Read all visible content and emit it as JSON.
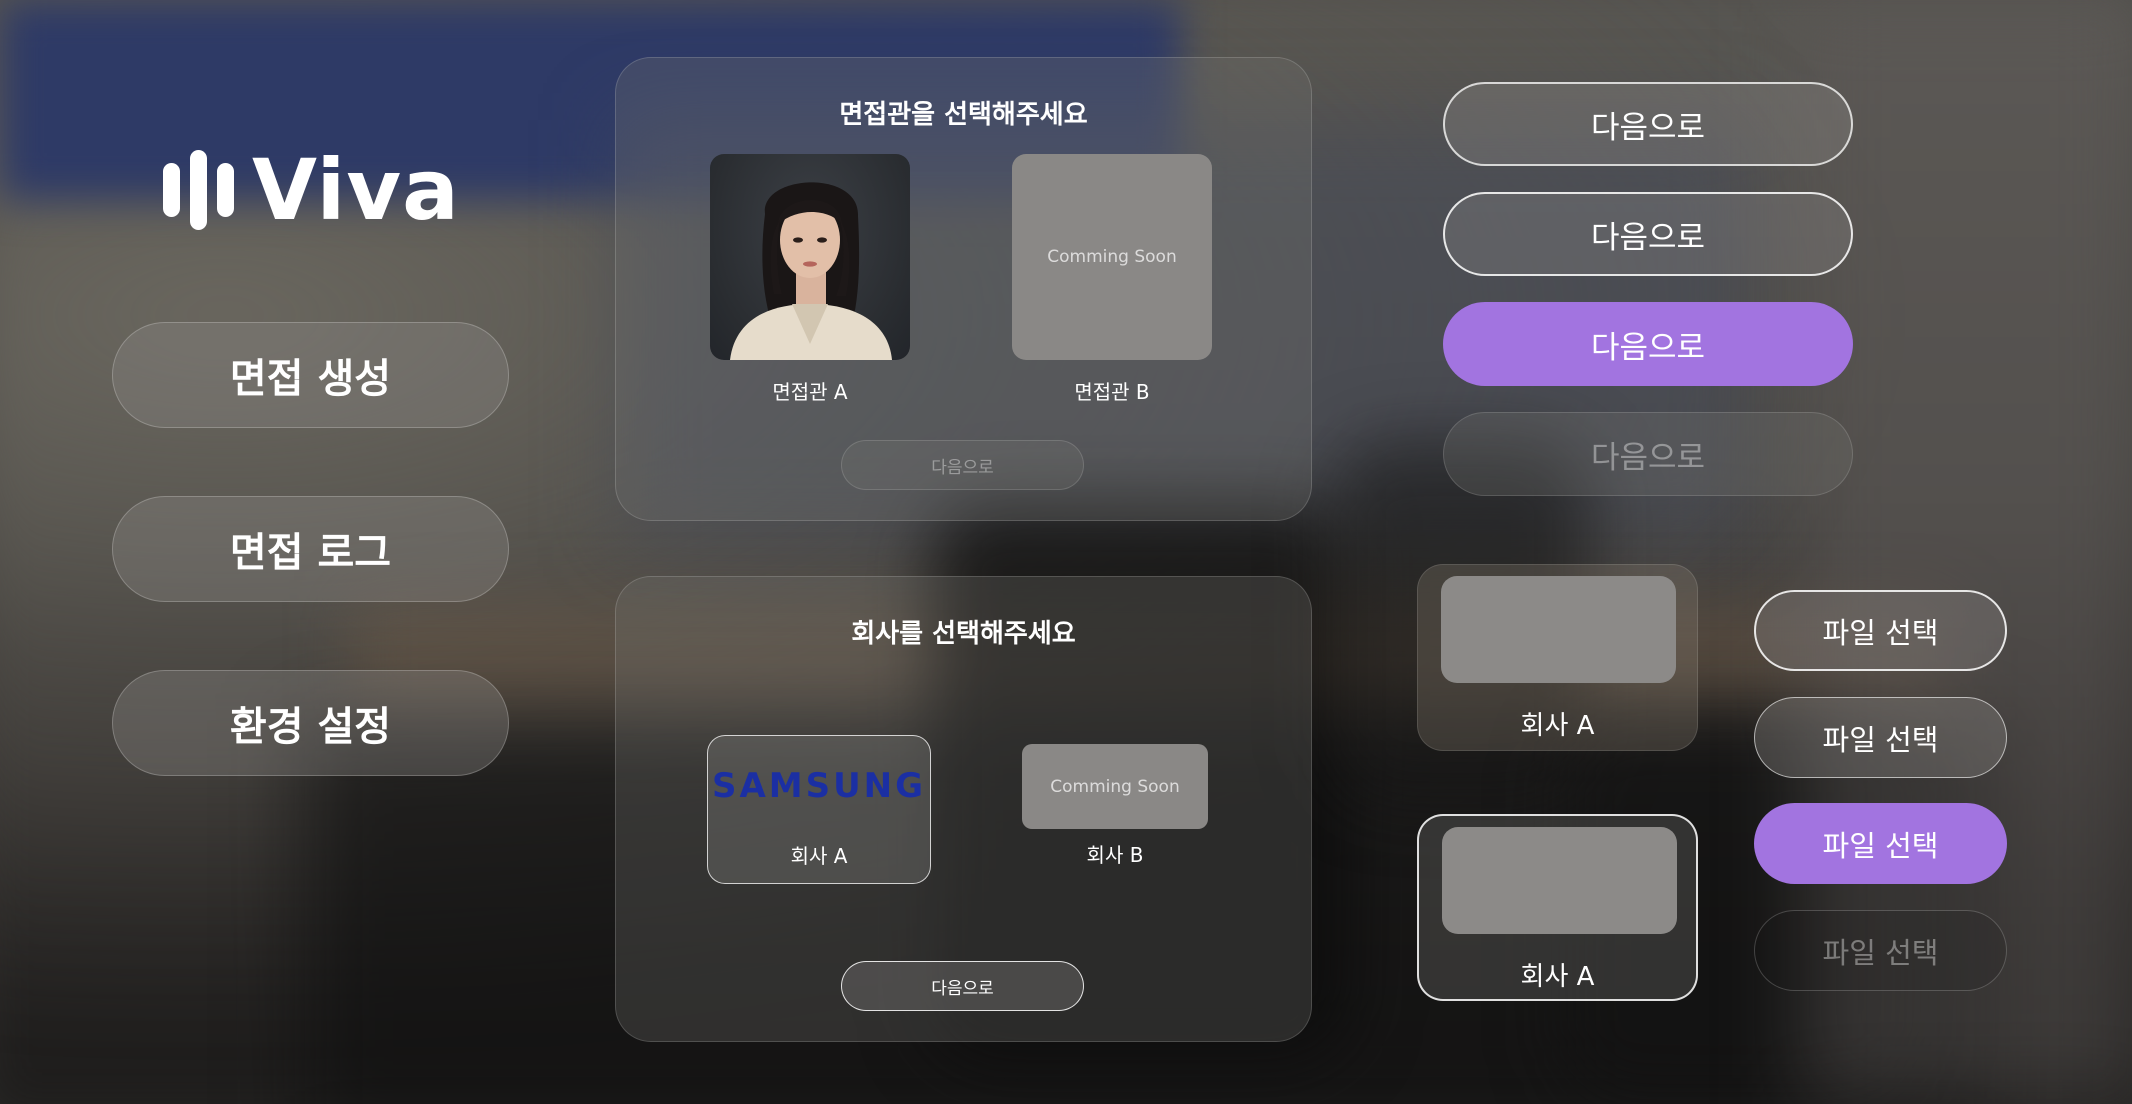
{
  "app": {
    "logo_text": "Viva"
  },
  "nav": {
    "items": [
      {
        "label": "면접 생성"
      },
      {
        "label": "면접 로그"
      },
      {
        "label": "환경 설정"
      }
    ]
  },
  "interviewer_panel": {
    "title": "면접관을 선택해주세요",
    "options": [
      {
        "label": "면접관 A"
      },
      {
        "label": "면접관 B",
        "placeholder_text": "Comming Soon"
      }
    ],
    "next_label": "다음으로"
  },
  "company_panel": {
    "title": "회사를 선택해주세요",
    "options": [
      {
        "label": "회사 A",
        "logo_text": "SAMSUNG"
      },
      {
        "label": "회사 B",
        "placeholder_text": "Comming Soon"
      }
    ],
    "next_label": "다음으로"
  },
  "next_buttons": [
    {
      "label": "다음으로",
      "state": "default"
    },
    {
      "label": "다음으로",
      "state": "outlined"
    },
    {
      "label": "다음으로",
      "state": "active"
    },
    {
      "label": "다음으로",
      "state": "disabled"
    }
  ],
  "company_widgets": [
    {
      "label": "회사 A",
      "state": "default"
    },
    {
      "label": "회사 A",
      "state": "selected"
    }
  ],
  "file_buttons": [
    {
      "label": "파일 선택",
      "state": "outlined"
    },
    {
      "label": "파일 선택",
      "state": "default"
    },
    {
      "label": "파일 선택",
      "state": "active"
    },
    {
      "label": "파일 선택",
      "state": "disabled"
    }
  ],
  "colors": {
    "accent_purple": "#a274e0",
    "samsung_blue": "#1b2fa3",
    "placeholder_gray": "#8a8886"
  }
}
